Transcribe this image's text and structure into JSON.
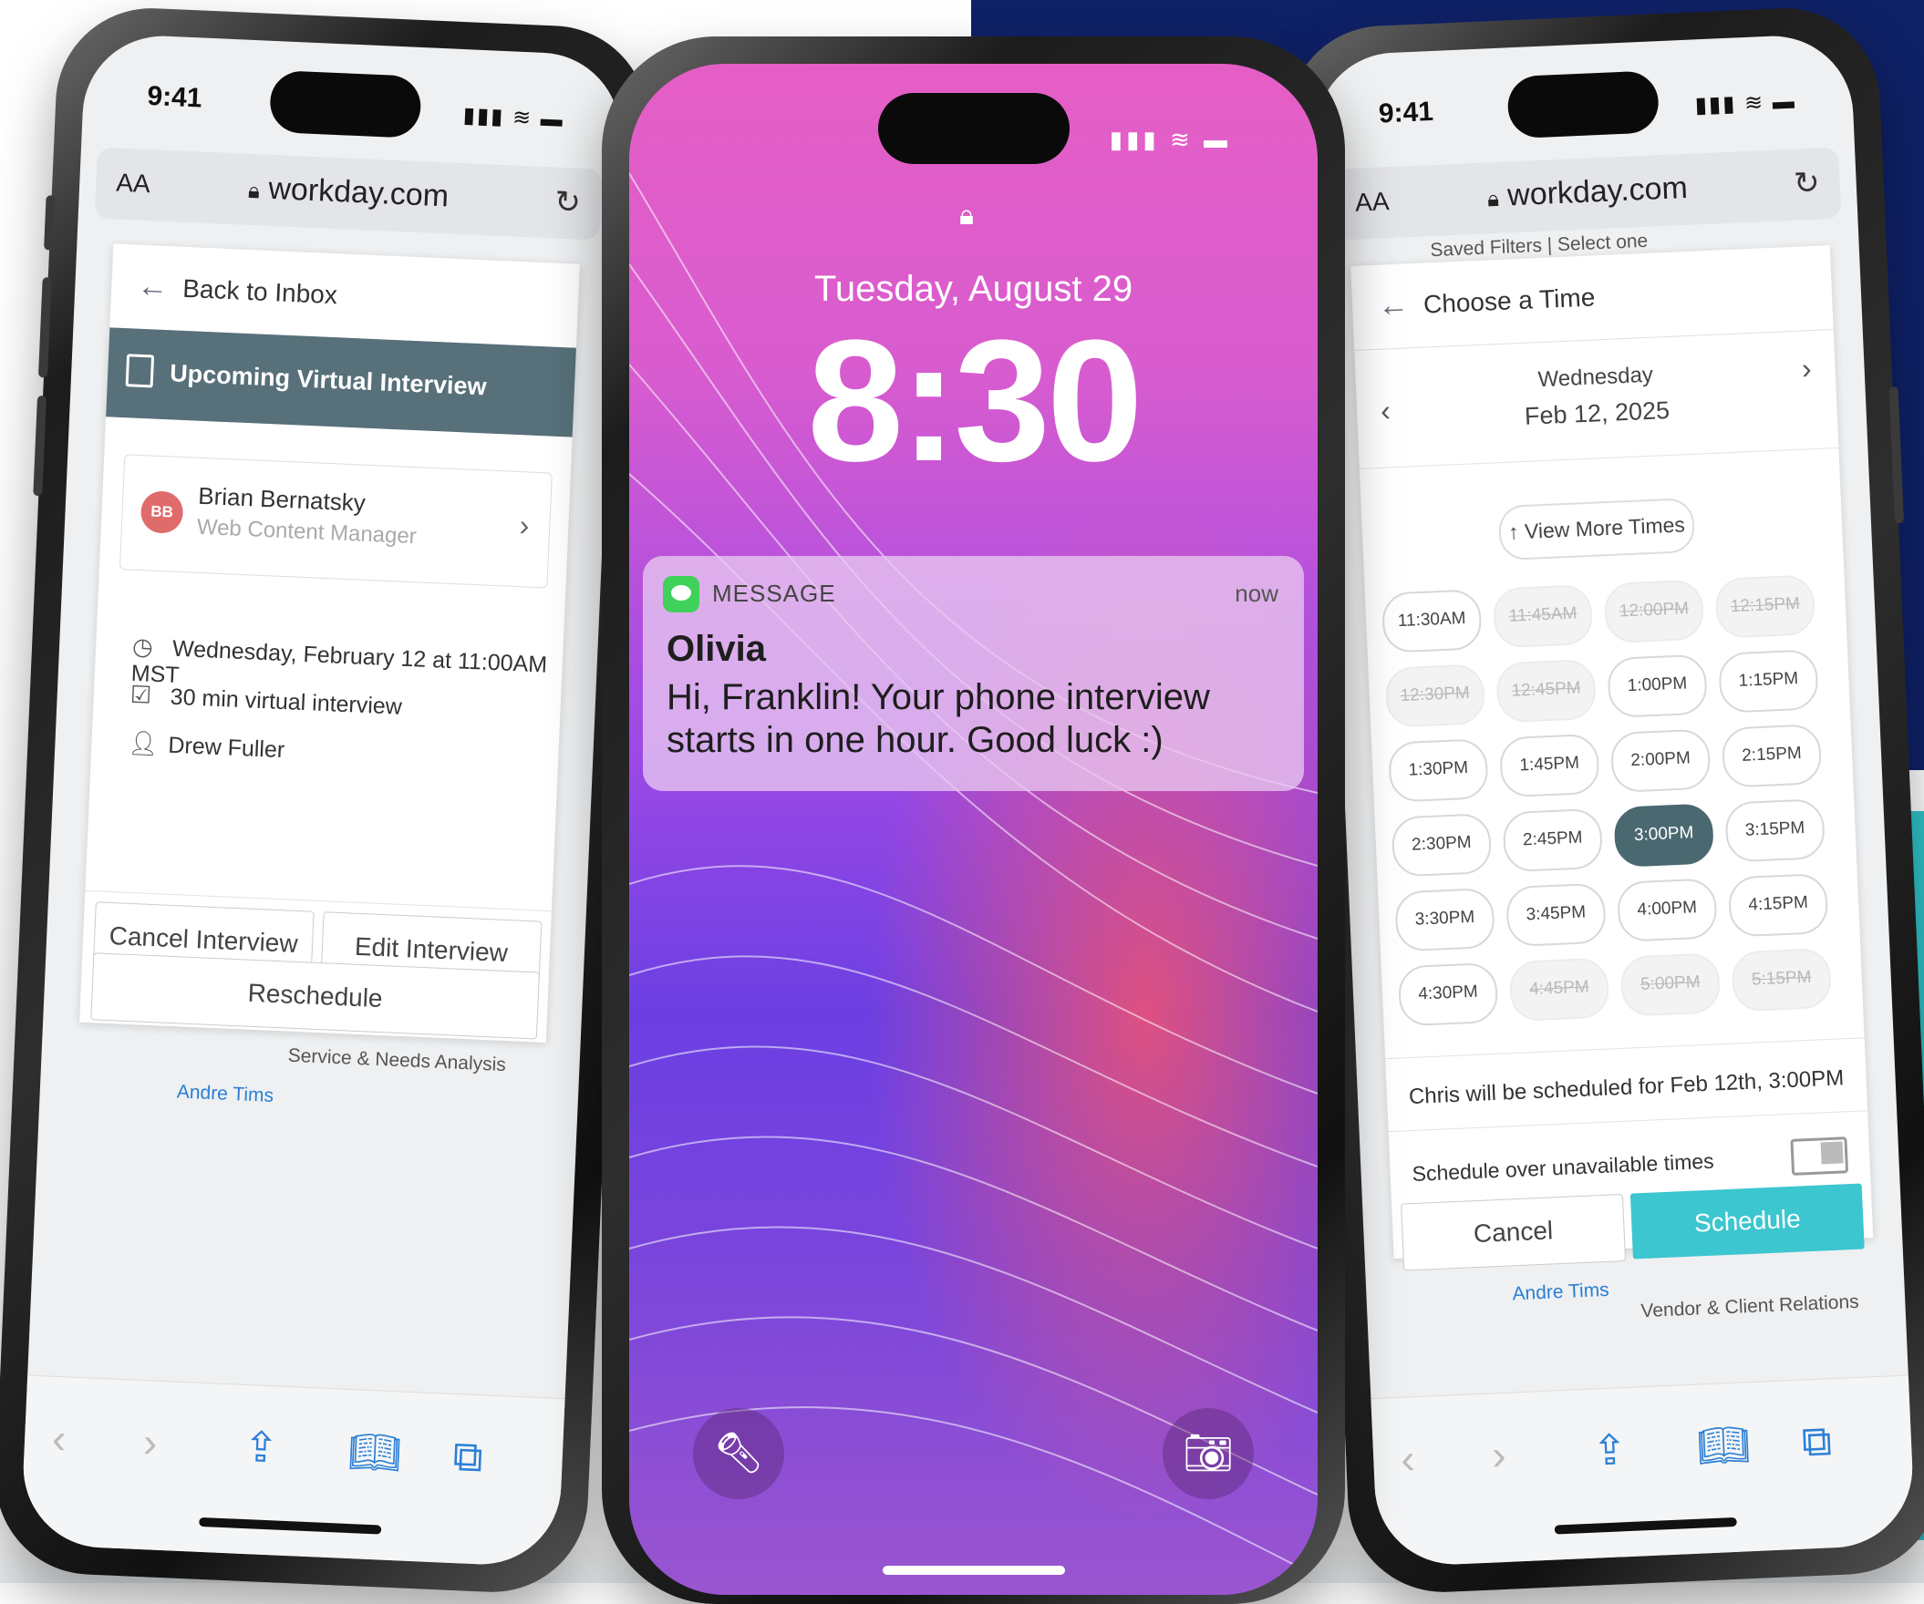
{
  "left_phone": {
    "status": {
      "time": "9:41"
    },
    "browser": {
      "text_size": "AA",
      "url": "workday.com"
    },
    "nav": {
      "back_label": "Back to Inbox"
    },
    "banner": {
      "label": "Upcoming Virtual Interview"
    },
    "candidate": {
      "initials": "BB",
      "name": "Brian Bernatsky",
      "role": "Web Content Manager"
    },
    "details": {
      "datetime": "Wednesday, February 12 at 11:00AM MST",
      "type": "30 min virtual interview",
      "interviewer": "Drew Fuller"
    },
    "actions": {
      "cancel": "Cancel Interview",
      "edit": "Edit Interview",
      "reschedule": "Reschedule"
    },
    "behind": {
      "text1": "Service & Needs Analysis",
      "text2": "Andre Tims"
    }
  },
  "center_phone": {
    "lock": {
      "date": "Tuesday, August 29",
      "time": "8:30"
    },
    "notification": {
      "app": "MESSAGE",
      "time": "now",
      "sender": "Olivia",
      "body": "Hi, Franklin! Your phone interview starts in one hour. Good luck :)"
    }
  },
  "right_phone": {
    "status": {
      "time": "9:41"
    },
    "browser": {
      "text_size": "AA",
      "url": "workday.com"
    },
    "behind_top": {
      "text": "Saved Filters | Select one"
    },
    "header": {
      "title": "Choose a Time"
    },
    "date": {
      "weekday": "Wednesday",
      "date": "Feb 12, 2025"
    },
    "view_more": "View More Times",
    "slots": [
      {
        "time": "11:30AM",
        "state": "available"
      },
      {
        "time": "11:45AM",
        "state": "unavailable"
      },
      {
        "time": "12:00PM",
        "state": "unavailable"
      },
      {
        "time": "12:15PM",
        "state": "unavailable"
      },
      {
        "time": "12:30PM",
        "state": "unavailable"
      },
      {
        "time": "12:45PM",
        "state": "unavailable"
      },
      {
        "time": "1:00PM",
        "state": "available"
      },
      {
        "time": "1:15PM",
        "state": "available"
      },
      {
        "time": "1:30PM",
        "state": "available"
      },
      {
        "time": "1:45PM",
        "state": "available"
      },
      {
        "time": "2:00PM",
        "state": "available"
      },
      {
        "time": "2:15PM",
        "state": "available"
      },
      {
        "time": "2:30PM",
        "state": "available"
      },
      {
        "time": "2:45PM",
        "state": "available"
      },
      {
        "time": "3:00PM",
        "state": "selected"
      },
      {
        "time": "3:15PM",
        "state": "available"
      },
      {
        "time": "3:30PM",
        "state": "available"
      },
      {
        "time": "3:45PM",
        "state": "available"
      },
      {
        "time": "4:00PM",
        "state": "available"
      },
      {
        "time": "4:15PM",
        "state": "available"
      },
      {
        "time": "4:30PM",
        "state": "available"
      },
      {
        "time": "4:45PM",
        "state": "unavailable"
      },
      {
        "time": "5:00PM",
        "state": "unavailable"
      },
      {
        "time": "5:15PM",
        "state": "unavailable"
      }
    ],
    "summary": "Chris will be scheduled for Feb 12th, 3:00PM",
    "toggle_label": "Schedule over unavailable times",
    "toggle_on": false,
    "actions": {
      "cancel": "Cancel",
      "schedule": "Schedule"
    },
    "behind": {
      "text1": "Andre Tims",
      "text2": "Vendor & Client Relations"
    }
  },
  "colors": {
    "navy_bg": "#0f2167",
    "teal_bg": "#2fc4c9",
    "banner": "#577079",
    "selected_slot": "#4a6870",
    "schedule_button": "#3cc6cf",
    "safari_blue": "#2b7fd6"
  },
  "icons": [
    "lock-icon",
    "calendar-icon",
    "clock-icon",
    "calendar-check-icon",
    "person-icon",
    "chevron-right-icon",
    "chevron-left-icon",
    "back-arrow-icon",
    "reload-icon",
    "flashlight-icon",
    "camera-icon",
    "share-icon",
    "bookmarks-icon",
    "tabs-icon",
    "message-app-icon",
    "signal-icon",
    "wifi-icon",
    "battery-icon"
  ]
}
